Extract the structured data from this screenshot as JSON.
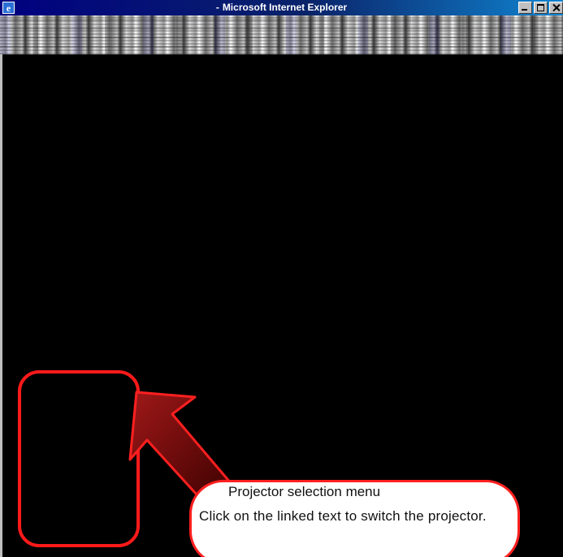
{
  "window": {
    "title_prefix": "-",
    "title": "Microsoft Internet Explorer",
    "controls": {
      "minimize": "minimize-icon",
      "maximize": "maximize-icon",
      "close": "close-icon"
    }
  },
  "callout": {
    "title": "Projector selection menu",
    "body": "Click on the linked text to switch the projector.",
    "border_color": "#ff2020",
    "arrow_color": "#8b1010"
  },
  "highlight": {
    "color": "#ff1a1a"
  },
  "content": {
    "background": "#000000"
  }
}
